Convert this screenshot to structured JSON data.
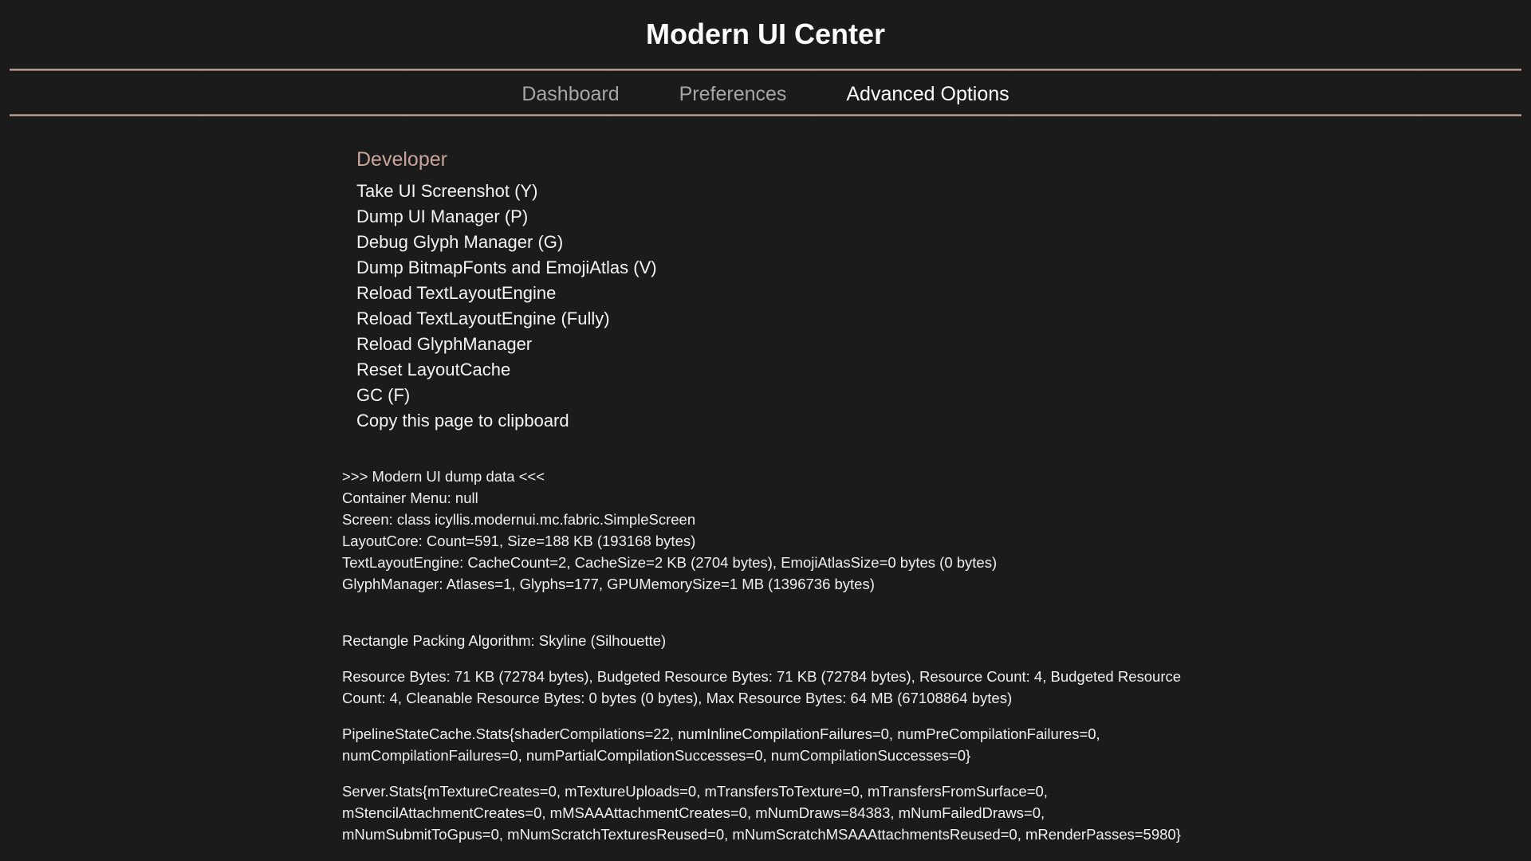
{
  "header": {
    "title": "Modern UI Center"
  },
  "tabs": [
    {
      "label": "Dashboard",
      "active": false
    },
    {
      "label": "Preferences",
      "active": false
    },
    {
      "label": "Advanced Options",
      "active": true
    }
  ],
  "developer": {
    "header": "Developer",
    "items": [
      "Take UI Screenshot (Y)",
      "Dump UI Manager (P)",
      "Debug Glyph Manager (G)",
      "Dump BitmapFonts and EmojiAtlas (V)",
      "Reload TextLayoutEngine",
      "Reload TextLayoutEngine (Fully)",
      "Reload GlyphManager",
      "Reset LayoutCache",
      "GC (F)",
      "Copy this page to clipboard"
    ]
  },
  "dump": {
    "lines": [
      ">>> Modern UI dump data <<<",
      "Container Menu: null",
      "Screen: class icyllis.modernui.mc.fabric.SimpleScreen",
      "LayoutCore: Count=591, Size=188 KB (193168 bytes)",
      "TextLayoutEngine: CacheCount=2, CacheSize=2 KB (2704 bytes), EmojiAtlasSize=0 bytes (0 bytes)",
      "GlyphManager: Atlases=1, Glyphs=177, GPUMemorySize=1 MB (1396736 bytes)"
    ],
    "packing": "Rectangle Packing Algorithm: Skyline (Silhouette)",
    "resources": "Resource Bytes: 71 KB (72784 bytes), Budgeted Resource Bytes: 71 KB (72784 bytes), Resource Count: 4, Budgeted Resource Count: 4, Cleanable Resource Bytes: 0 bytes (0 bytes), Max Resource Bytes: 64 MB (67108864 bytes)",
    "pipeline": "PipelineStateCache.Stats{shaderCompilations=22, numInlineCompilationFailures=0, numPreCompilationFailures=0, numCompilationFailures=0, numPartialCompilationSuccesses=0, numCompilationSuccesses=0}",
    "server": "Server.Stats{mTextureCreates=0, mTextureUploads=0, mTransfersToTexture=0, mTransfersFromSurface=0, mStencilAttachmentCreates=0, mMSAAAttachmentCreates=0, mNumDraws=84383, mNumFailedDraws=0, mNumSubmitToGpus=0, mNumScratchTexturesReused=0, mNumScratchMSAAAttachmentsReused=0, mRenderPasses=5980}"
  }
}
